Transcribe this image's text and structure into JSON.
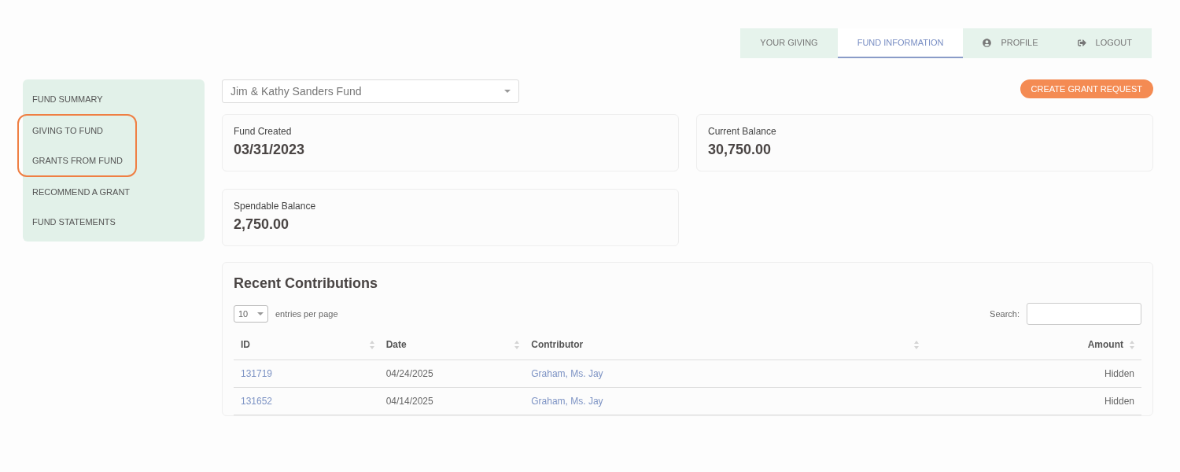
{
  "nav_tabs": [
    {
      "label": "YOUR GIVING",
      "selected": false
    },
    {
      "label": "FUND INFORMATION",
      "selected": true
    },
    {
      "label": "PROFILE",
      "selected": false
    },
    {
      "label": "LOGOUT",
      "selected": false
    }
  ],
  "sidebar": {
    "items": [
      {
        "label": "FUND SUMMARY",
        "highlighted": false
      },
      {
        "label": "GIVING TO FUND",
        "highlighted": true
      },
      {
        "label": "GRANTS FROM FUND",
        "highlighted": true
      },
      {
        "label": "RECOMMEND A GRANT",
        "highlighted": false
      },
      {
        "label": "FUND STATEMENTS",
        "highlighted": false
      }
    ]
  },
  "fund_select": {
    "value": "Jim & Kathy Sanders Fund"
  },
  "create_button": "CREATE GRANT REQUEST",
  "stat_cards": [
    {
      "label": "Fund Created",
      "value": "03/31/2023"
    },
    {
      "label": "Current Balance",
      "value": "30,750.00"
    },
    {
      "label": "Spendable Balance",
      "value": "2,750.00"
    }
  ],
  "contributions": {
    "title": "Recent Contributions",
    "page_size": "10",
    "page_size_label": "entries per page",
    "search_label": "Search:",
    "columns": [
      "ID",
      "Date",
      "Contributor",
      "Amount"
    ],
    "rows": [
      {
        "id": "131719",
        "date": "04/24/2025",
        "contributor": "Graham, Ms. Jay",
        "amount": "Hidden"
      },
      {
        "id": "131652",
        "date": "04/14/2025",
        "contributor": "Graham, Ms. Jay",
        "amount": "Hidden"
      }
    ]
  }
}
